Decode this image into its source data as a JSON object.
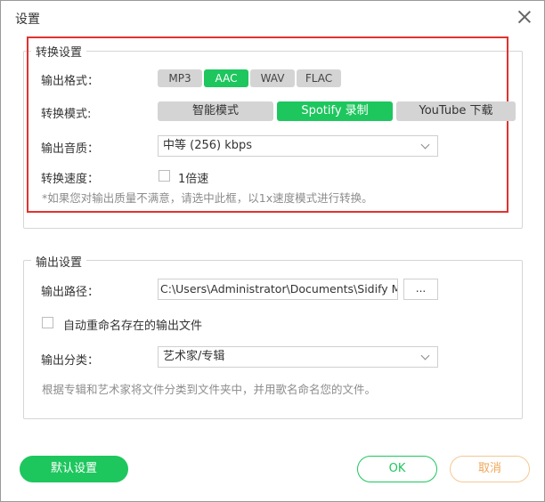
{
  "window": {
    "title": "设置"
  },
  "conversion": {
    "legend": "转换设置",
    "format": {
      "label": "输出格式：",
      "options": [
        "MP3",
        "AAC",
        "WAV",
        "FLAC"
      ],
      "selected": "AAC"
    },
    "mode": {
      "label": "转换模式:",
      "options": [
        "智能模式",
        "Spotify 录制",
        "YouTube 下载"
      ],
      "selected": "Spotify 录制"
    },
    "quality": {
      "label": "输出音质：",
      "value": "中等 (256) kbps"
    },
    "speed": {
      "label": "转换速度：",
      "checkbox_label": "1倍速",
      "checked": false
    },
    "hint": "*如果您对输出质量不满意，请选中此框，以1x速度模式进行转换。"
  },
  "output": {
    "legend": "输出设置",
    "path": {
      "label": "输出路径：",
      "value": "C:\\Users\\Administrator\\Documents\\Sidify M",
      "browse_label": "..."
    },
    "rename": {
      "label": "自动重命名存在的输出文件",
      "checked": false
    },
    "category": {
      "label": "输出分类：",
      "value": "艺术家/专辑"
    },
    "hint": "根据专辑和艺术家将文件分类到文件夹中，并用歌名命名您的文件。"
  },
  "footer": {
    "default_label": "默认设置",
    "ok_label": "OK",
    "cancel_label": "取消"
  },
  "colors": {
    "accent": "#1ec65e",
    "highlight_border": "#e0332f",
    "cancel": "#f0a65a"
  }
}
